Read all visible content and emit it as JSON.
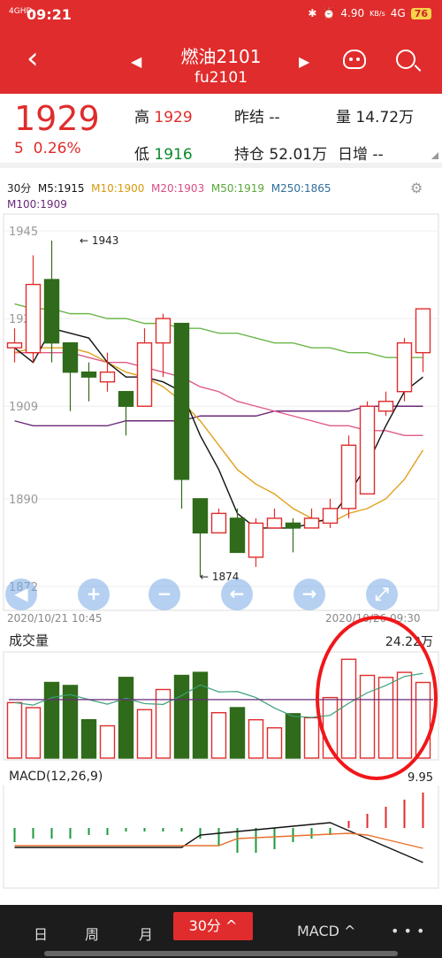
{
  "status_bar": {
    "signal": "4GHD",
    "time": "09:21",
    "net_speed": "4.90",
    "net_unit": "KB/s",
    "net_type": "4G",
    "battery": "76"
  },
  "header": {
    "name": "燃油2101",
    "code": "fu2101"
  },
  "quote": {
    "price": "1929",
    "change": "5",
    "change_pct": "0.26%",
    "high_label": "高",
    "high": "1929",
    "low_label": "低",
    "low": "1916",
    "prev_settle_label": "昨结",
    "prev_settle": "--",
    "volume_label": "量",
    "volume": "14.72万",
    "open_interest_label": "持仓",
    "open_interest": "52.01万",
    "daily_increase_label": "日增",
    "daily_increase": "--"
  },
  "chart_header": {
    "period": "30分",
    "ma5": "M5:1915",
    "ma10": "M10:1900",
    "ma20": "M20:1903",
    "ma50": "M50:1919",
    "ma250": "M250:1865",
    "ma100": "M100:1909"
  },
  "colors": {
    "ma5": "#111111",
    "ma10": "#e0a01c",
    "ma20": "#e05a8a",
    "ma50": "#6ab84a",
    "ma250": "#3a78a8",
    "ma100": "#6a2a7a",
    "up": "#e02c2c",
    "down": "#2f6b1a"
  },
  "main_chart": {
    "y_ticks": [
      "1945",
      "1927",
      "1909",
      "1890",
      "1872"
    ],
    "high_annotation": "1943",
    "low_annotation": "1874",
    "time_start": "2020/10/21 10:45",
    "time_end": "2020/10/26 09:30"
  },
  "volume": {
    "label": "成交量",
    "value": "24.22万"
  },
  "macd": {
    "label": "MACD(12,26,9)",
    "value": "9.95"
  },
  "bottom_tabs": {
    "day": "日",
    "week": "周",
    "month": "月",
    "period": "30分 ^",
    "indicator": "MACD ^",
    "more": "• • •"
  },
  "chart_data": {
    "type": "candlestick",
    "candles": [
      {
        "o": 1921,
        "c": 1922,
        "h": 1925,
        "l": 1918
      },
      {
        "o": 1920,
        "c": 1934,
        "h": 1940,
        "l": 1918
      },
      {
        "o": 1935,
        "c": 1922,
        "h": 1943,
        "l": 1918
      },
      {
        "o": 1922,
        "c": 1916,
        "h": 1922,
        "l": 1908
      },
      {
        "o": 1916,
        "c": 1915,
        "h": 1918,
        "l": 1910
      },
      {
        "o": 1914,
        "c": 1916,
        "h": 1920,
        "l": 1912
      },
      {
        "o": 1912,
        "c": 1909,
        "h": 1912,
        "l": 1903
      },
      {
        "o": 1909,
        "c": 1922,
        "h": 1925,
        "l": 1909
      },
      {
        "o": 1922,
        "c": 1927,
        "h": 1928,
        "l": 1915
      },
      {
        "o": 1926,
        "c": 1894,
        "h": 1926,
        "l": 1888
      },
      {
        "o": 1890,
        "c": 1883,
        "h": 1890,
        "l": 1874
      },
      {
        "o": 1883,
        "c": 1887,
        "h": 1888,
        "l": 1883
      },
      {
        "o": 1886,
        "c": 1879,
        "h": 1888,
        "l": 1879
      },
      {
        "o": 1878,
        "c": 1885,
        "h": 1886,
        "l": 1876
      },
      {
        "o": 1884,
        "c": 1886,
        "h": 1888,
        "l": 1884
      },
      {
        "o": 1885,
        "c": 1884,
        "h": 1886,
        "l": 1879
      },
      {
        "o": 1884,
        "c": 1886,
        "h": 1888,
        "l": 1884
      },
      {
        "o": 1885,
        "c": 1888,
        "h": 1890,
        "l": 1884
      },
      {
        "o": 1888,
        "c": 1901,
        "h": 1903,
        "l": 1886
      },
      {
        "o": 1891,
        "c": 1909,
        "h": 1910,
        "l": 1891
      },
      {
        "o": 1908,
        "c": 1910,
        "h": 1912,
        "l": 1907
      },
      {
        "o": 1912,
        "c": 1922,
        "h": 1923,
        "l": 1910
      },
      {
        "o": 1920,
        "c": 1929,
        "h": 1929,
        "l": 1916
      }
    ],
    "ma5": [
      1921,
      1918,
      1925,
      1924,
      1923,
      1918,
      1915,
      1915,
      1914,
      1912,
      1903,
      1896,
      1887,
      1884,
      1884,
      1884,
      1885,
      1886,
      1891,
      1897,
      1905,
      1912,
      1915
    ],
    "ma10": [
      1920,
      1921,
      1921,
      1921,
      1920,
      1918,
      1916,
      1915,
      1913,
      1910,
      1906,
      1901,
      1896,
      1893,
      1891,
      1888,
      1886,
      1885,
      1887,
      1888,
      1890,
      1894,
      1900
    ],
    "ma20": [
      1920,
      1920,
      1920,
      1920,
      1919,
      1918,
      1918,
      1917,
      1916,
      1915,
      1913,
      1912,
      1910,
      1909,
      1908,
      1907,
      1906,
      1905,
      1905,
      1904,
      1904,
      1903,
      1903
    ],
    "ma50": [
      1930,
      1929,
      1929,
      1928,
      1928,
      1927,
      1927,
      1926,
      1926,
      1925,
      1925,
      1924,
      1924,
      1923,
      1922,
      1922,
      1921,
      1921,
      1920,
      1920,
      1919,
      1919,
      1919
    ],
    "ma100": [
      1906,
      1905,
      1905,
      1905,
      1905,
      1905,
      1906,
      1906,
      1906,
      1906,
      1907,
      1907,
      1907,
      1907,
      1908,
      1908,
      1908,
      1908,
      1908,
      1909,
      1909,
      1909,
      1909
    ],
    "volume_bars": [
      55,
      50,
      75,
      72,
      38,
      32,
      80,
      48,
      68,
      82,
      85,
      45,
      50,
      38,
      30,
      44,
      40,
      60,
      98,
      82,
      80,
      85,
      75
    ],
    "macd_hist": [
      -4,
      -3,
      -3,
      -3,
      -2,
      -2,
      -1,
      -1,
      -1,
      -1,
      -3,
      -5,
      -7,
      -7,
      -6,
      -4,
      -3,
      -2,
      2,
      4,
      6,
      8,
      10
    ]
  }
}
